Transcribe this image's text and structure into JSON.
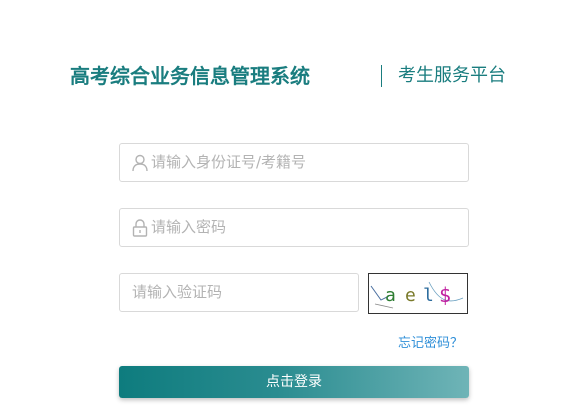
{
  "header": {
    "system_title": "高考综合业务信息管理系统",
    "sub_title": "考生服务平台"
  },
  "form": {
    "username_placeholder": "请输入身份证号/考籍号",
    "password_placeholder": "请输入密码",
    "captcha_placeholder": "请输入验证码",
    "captcha_text": "ael$",
    "forgot_label": "忘记密码？",
    "login_label": "点击登录"
  },
  "colors": {
    "accent": "#1a7d7f",
    "link": "#2f8fd8",
    "border": "#d9d9d9"
  },
  "icons": {
    "username": "user-icon",
    "password": "lock-icon"
  }
}
